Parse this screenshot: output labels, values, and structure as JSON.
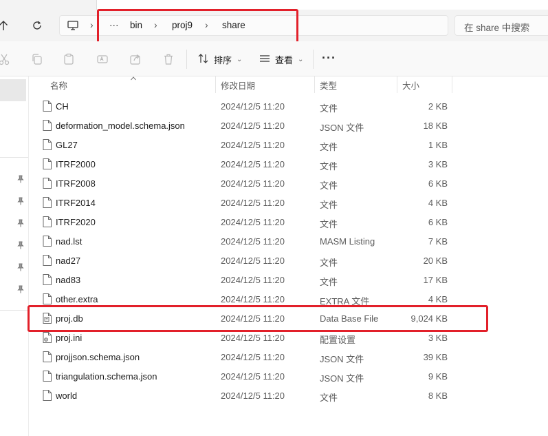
{
  "nav": {
    "address_parts": [
      "···",
      "bin",
      "proj9",
      "share"
    ],
    "search_placeholder": "在 share 中搜索"
  },
  "toolbar": {
    "sort_label": "排序",
    "view_label": "查看",
    "more_label": "···"
  },
  "columns": {
    "name": "名称",
    "modified": "修改日期",
    "type": "类型",
    "size": "大小"
  },
  "files": [
    {
      "name": "CH",
      "modified": "2024/12/5 11:20",
      "type": "文件",
      "size": "2 KB",
      "icon": "file-icon"
    },
    {
      "name": "deformation_model.schema.json",
      "modified": "2024/12/5 11:20",
      "type": "JSON 文件",
      "size": "18 KB",
      "icon": "file-icon"
    },
    {
      "name": "GL27",
      "modified": "2024/12/5 11:20",
      "type": "文件",
      "size": "1 KB",
      "icon": "file-icon"
    },
    {
      "name": "ITRF2000",
      "modified": "2024/12/5 11:20",
      "type": "文件",
      "size": "3 KB",
      "icon": "file-icon"
    },
    {
      "name": "ITRF2008",
      "modified": "2024/12/5 11:20",
      "type": "文件",
      "size": "6 KB",
      "icon": "file-icon"
    },
    {
      "name": "ITRF2014",
      "modified": "2024/12/5 11:20",
      "type": "文件",
      "size": "4 KB",
      "icon": "file-icon"
    },
    {
      "name": "ITRF2020",
      "modified": "2024/12/5 11:20",
      "type": "文件",
      "size": "6 KB",
      "icon": "file-icon"
    },
    {
      "name": "nad.lst",
      "modified": "2024/12/5 11:20",
      "type": "MASM Listing",
      "size": "7 KB",
      "icon": "file-icon"
    },
    {
      "name": "nad27",
      "modified": "2024/12/5 11:20",
      "type": "文件",
      "size": "20 KB",
      "icon": "file-icon"
    },
    {
      "name": "nad83",
      "modified": "2024/12/5 11:20",
      "type": "文件",
      "size": "17 KB",
      "icon": "file-icon"
    },
    {
      "name": "other.extra",
      "modified": "2024/12/5 11:20",
      "type": "EXTRA 文件",
      "size": "4 KB",
      "icon": "file-icon"
    },
    {
      "name": "proj.db",
      "modified": "2024/12/5 11:20",
      "type": "Data Base File",
      "size": "9,024 KB",
      "icon": "database-file-icon"
    },
    {
      "name": "proj.ini",
      "modified": "2024/12/5 11:20",
      "type": "配置设置",
      "size": "3 KB",
      "icon": "settings-file-icon"
    },
    {
      "name": "projjson.schema.json",
      "modified": "2024/12/5 11:20",
      "type": "JSON 文件",
      "size": "39 KB",
      "icon": "file-icon"
    },
    {
      "name": "triangulation.schema.json",
      "modified": "2024/12/5 11:20",
      "type": "JSON 文件",
      "size": "9 KB",
      "icon": "file-icon"
    },
    {
      "name": "world",
      "modified": "2024/12/5 11:20",
      "type": "文件",
      "size": "8 KB",
      "icon": "file-icon"
    }
  ],
  "colors": {
    "highlight_box": "#e2202a",
    "nav_background": "#f3f3f3",
    "selected_sidebar": "#e8e8e8"
  }
}
